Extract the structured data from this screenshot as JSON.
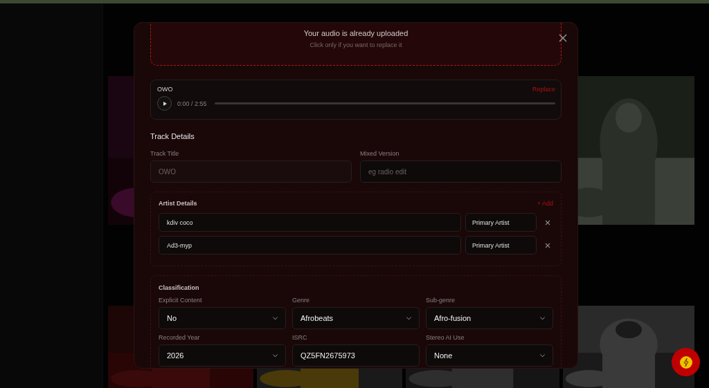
{
  "upload": {
    "title": "Your audio is already uploaded",
    "hint": "Click only if you want to replace it"
  },
  "audio": {
    "name": "OWO",
    "replace": "Replace",
    "time": "0:00 / 2:55"
  },
  "track_details": {
    "heading": "Track Details",
    "fields": [
      {
        "label": "Track Title",
        "placeholder": "OWO"
      },
      {
        "label": "Mixed Version",
        "placeholder": "eg radio edit"
      }
    ]
  },
  "artist_details": {
    "heading": "Artist Details",
    "add": "+ Add",
    "artists": [
      {
        "name": "kdiv coco",
        "role": "Primary Artist"
      },
      {
        "name": "Ad3-myp",
        "role": "Primary Artist"
      }
    ]
  },
  "classification": {
    "heading": "Classification",
    "fields": [
      {
        "label": "Explicit Content",
        "value": "No",
        "kind": "select"
      },
      {
        "label": "Genre",
        "value": "Afrobeats",
        "kind": "select"
      },
      {
        "label": "Sub-genre",
        "value": "Afro-fusion",
        "kind": "select"
      },
      {
        "label": "Recorded Year",
        "value": "2026",
        "kind": "select"
      },
      {
        "label": "ISRC",
        "value": "QZ5FN2675973",
        "kind": "text"
      },
      {
        "label": "Stereo AI Use",
        "value": "None",
        "kind": "select"
      }
    ]
  }
}
